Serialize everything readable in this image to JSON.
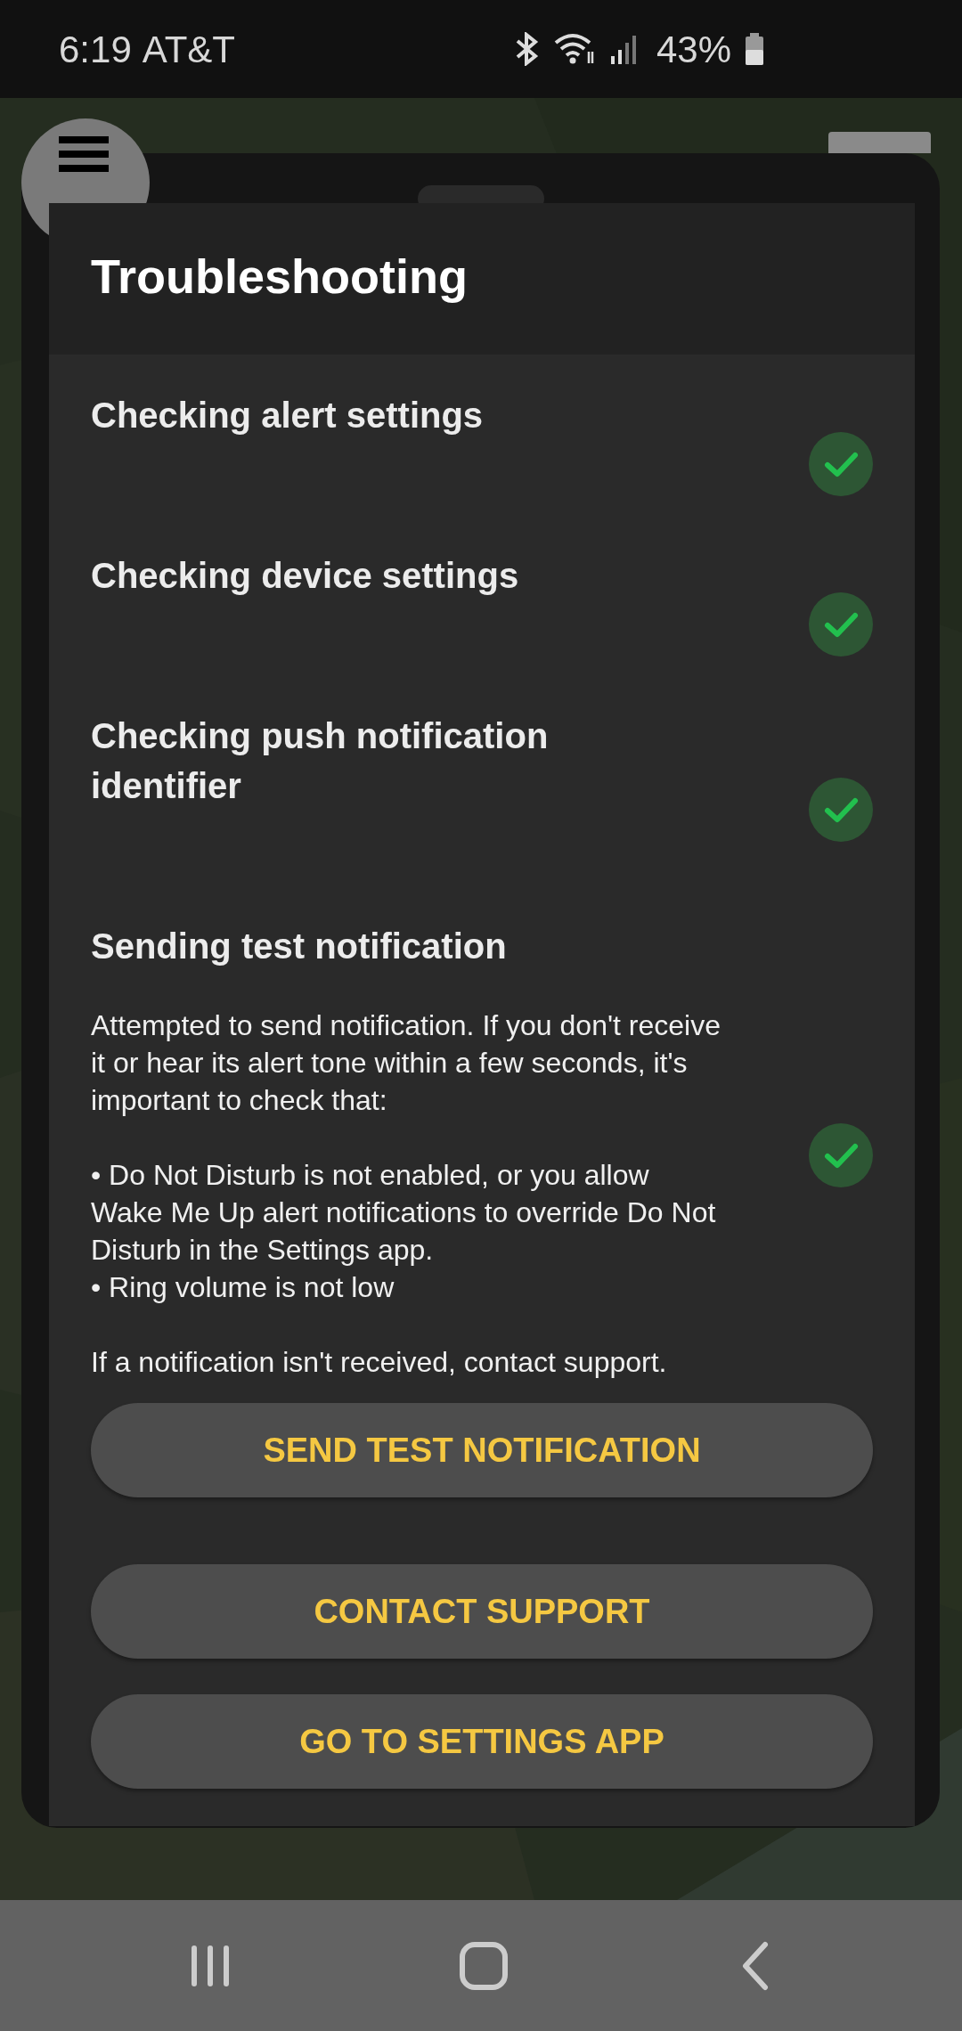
{
  "status_bar": {
    "time": "6:19",
    "carrier": "AT&T",
    "battery": "43%"
  },
  "dialog": {
    "title": "Troubleshooting",
    "steps": [
      {
        "title": "Checking alert settings",
        "checked": true
      },
      {
        "title": "Checking device settings",
        "checked": true
      },
      {
        "title": "Checking push notification identifier",
        "checked": true
      },
      {
        "title": "Sending test notification",
        "checked": true,
        "body": [
          {
            "kind": "paragraph",
            "text": "Attempted to send notification. If you don't receive it or hear its alert tone within a few seconds, it's important to check that:"
          },
          {
            "kind": "bullet",
            "text": "• Do Not Disturb is not enabled, or you allow Wake Me Up alert notifications to override Do Not Disturb in the Settings app."
          },
          {
            "kind": "bullet",
            "text": "• Ring volume is not low"
          },
          {
            "kind": "paragraph",
            "text": "If a notification isn't received, contact support."
          }
        ]
      }
    ],
    "buttons": [
      "SEND TEST NOTIFICATION",
      "CONTACT SUPPORT",
      "GO TO SETTINGS APP"
    ]
  }
}
